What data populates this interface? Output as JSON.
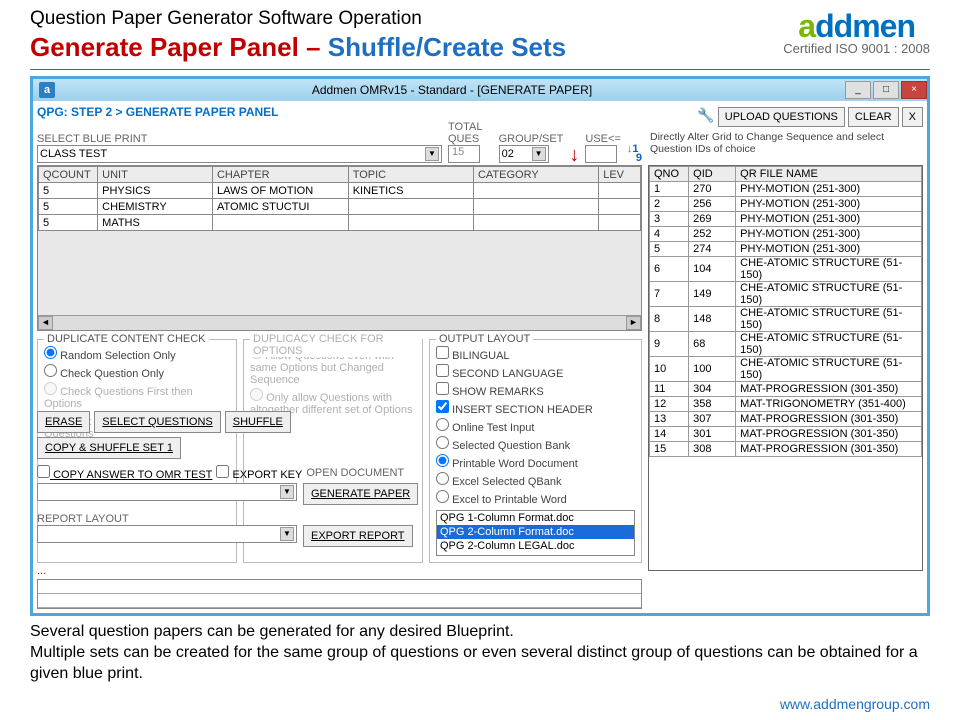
{
  "page": {
    "title": "Question Paper Generator Software Operation",
    "subtitle_red": "Generate Paper Panel",
    "subtitle_dash": " – ",
    "subtitle_blue": "Shuffle/Create Sets",
    "cert": "Certified ISO 9001 : 2008",
    "logo_a": "a",
    "logo_dd": "dd",
    "logo_men": "men"
  },
  "win": {
    "title": "Addmen OMRv15 - Standard - [GENERATE PAPER]",
    "icon": "a",
    "min": "_",
    "max": "□",
    "close": "×"
  },
  "crumb": "QPG: STEP 2 > GENERATE PAPER PANEL",
  "labels": {
    "select_bp": "SELECT BLUE PRINT",
    "total_q": "TOTAL QUES",
    "group_set": "GROUP/SET",
    "use": "USE<=",
    "upload": "UPLOAD QUESTIONS",
    "clear": "CLEAR",
    "directly": "Directly Alter Grid to Change Sequence and select Question IDs of choice"
  },
  "blueprint": {
    "value": "CLASS TEST",
    "total": "15",
    "group": "02"
  },
  "bp_grid": {
    "headers": [
      "QCOUNT",
      "UNIT",
      "CHAPTER",
      "TOPIC",
      "CATEGORY",
      "LEV"
    ],
    "rows": [
      [
        "5",
        "PHYSICS",
        "LAWS OF MOTION",
        "KINETICS",
        "",
        ""
      ],
      [
        "5",
        "CHEMISTRY",
        "ATOMIC STUCTUI",
        "",
        "",
        ""
      ],
      [
        "5",
        "MATHS",
        "",
        "",
        "",
        ""
      ]
    ]
  },
  "qgrid": {
    "headers": [
      "QNO",
      "QID",
      "QR FILE NAME"
    ],
    "rows": [
      [
        "1",
        "270",
        "PHY-MOTION (251-300)"
      ],
      [
        "2",
        "256",
        "PHY-MOTION (251-300)"
      ],
      [
        "3",
        "269",
        "PHY-MOTION (251-300)"
      ],
      [
        "4",
        "252",
        "PHY-MOTION (251-300)"
      ],
      [
        "5",
        "274",
        "PHY-MOTION (251-300)"
      ],
      [
        "6",
        "104",
        "CHE-ATOMIC STRUCTURE (51-150)"
      ],
      [
        "7",
        "149",
        "CHE-ATOMIC STRUCTURE (51-150)"
      ],
      [
        "8",
        "148",
        "CHE-ATOMIC STRUCTURE (51-150)"
      ],
      [
        "9",
        "68",
        "CHE-ATOMIC STRUCTURE (51-150)"
      ],
      [
        "10",
        "100",
        "CHE-ATOMIC STRUCTURE (51-150)"
      ],
      [
        "11",
        "304",
        "MAT-PROGRESSION (301-350)"
      ],
      [
        "12",
        "358",
        "MAT-TRIGONOMETRY (351-400)"
      ],
      [
        "13",
        "307",
        "MAT-PROGRESSION (301-350)"
      ],
      [
        "14",
        "301",
        "MAT-PROGRESSION (301-350)"
      ],
      [
        "15",
        "308",
        "MAT-PROGRESSION (301-350)"
      ]
    ]
  },
  "dup": {
    "title": "DUPLICATE CONTENT CHECK",
    "opts": [
      "Random Selection Only",
      "Check Question Only",
      "Check Questions First then Options",
      "Check Options First then Questions"
    ]
  },
  "dup2": {
    "title": "DUPLICACY CHECK FOR OPTIONS",
    "opts": [
      "Allow Questions even with same Options but Changed Sequence",
      "Only allow Questions with altogether different set of Options"
    ]
  },
  "out": {
    "title": "OUTPUT LAYOUT",
    "checks": [
      "BILINGUAL",
      "SECOND LANGUAGE",
      "SHOW REMARKS",
      "INSERT SECTION HEADER"
    ],
    "radios": [
      "Online Test Input",
      "Selected Question Bank",
      "Printable Word Document",
      "Excel Selected QBank",
      "Excel to Printable Word"
    ],
    "files": [
      "QPG 1-Column Format.doc",
      "QPG 2-Column Format.doc",
      "QPG 2-Column LEGAL.doc"
    ]
  },
  "btns": {
    "erase": "ERASE",
    "select_q": "SELECT QUESTIONS",
    "shuffle": "SHUFFLE",
    "copy_shuffle": "COPY & SHUFFLE  SET 1",
    "copy_omr": "COPY ANSWER TO OMR TEST",
    "export_key": "EXPORT KEY",
    "open_doc": "OPEN DOCUMENT",
    "gen_paper": "GENERATE PAPER",
    "report_layout": "REPORT LAYOUT",
    "export_report": "EXPORT REPORT"
  },
  "footer": {
    "l1": "Several question papers can be generated for any desired Blueprint.",
    "l2": "Multiple sets can be created for the same group of questions or even several distinct group of questions can be obtained for a given blue print.",
    "link": "www.addmengroup.com"
  }
}
